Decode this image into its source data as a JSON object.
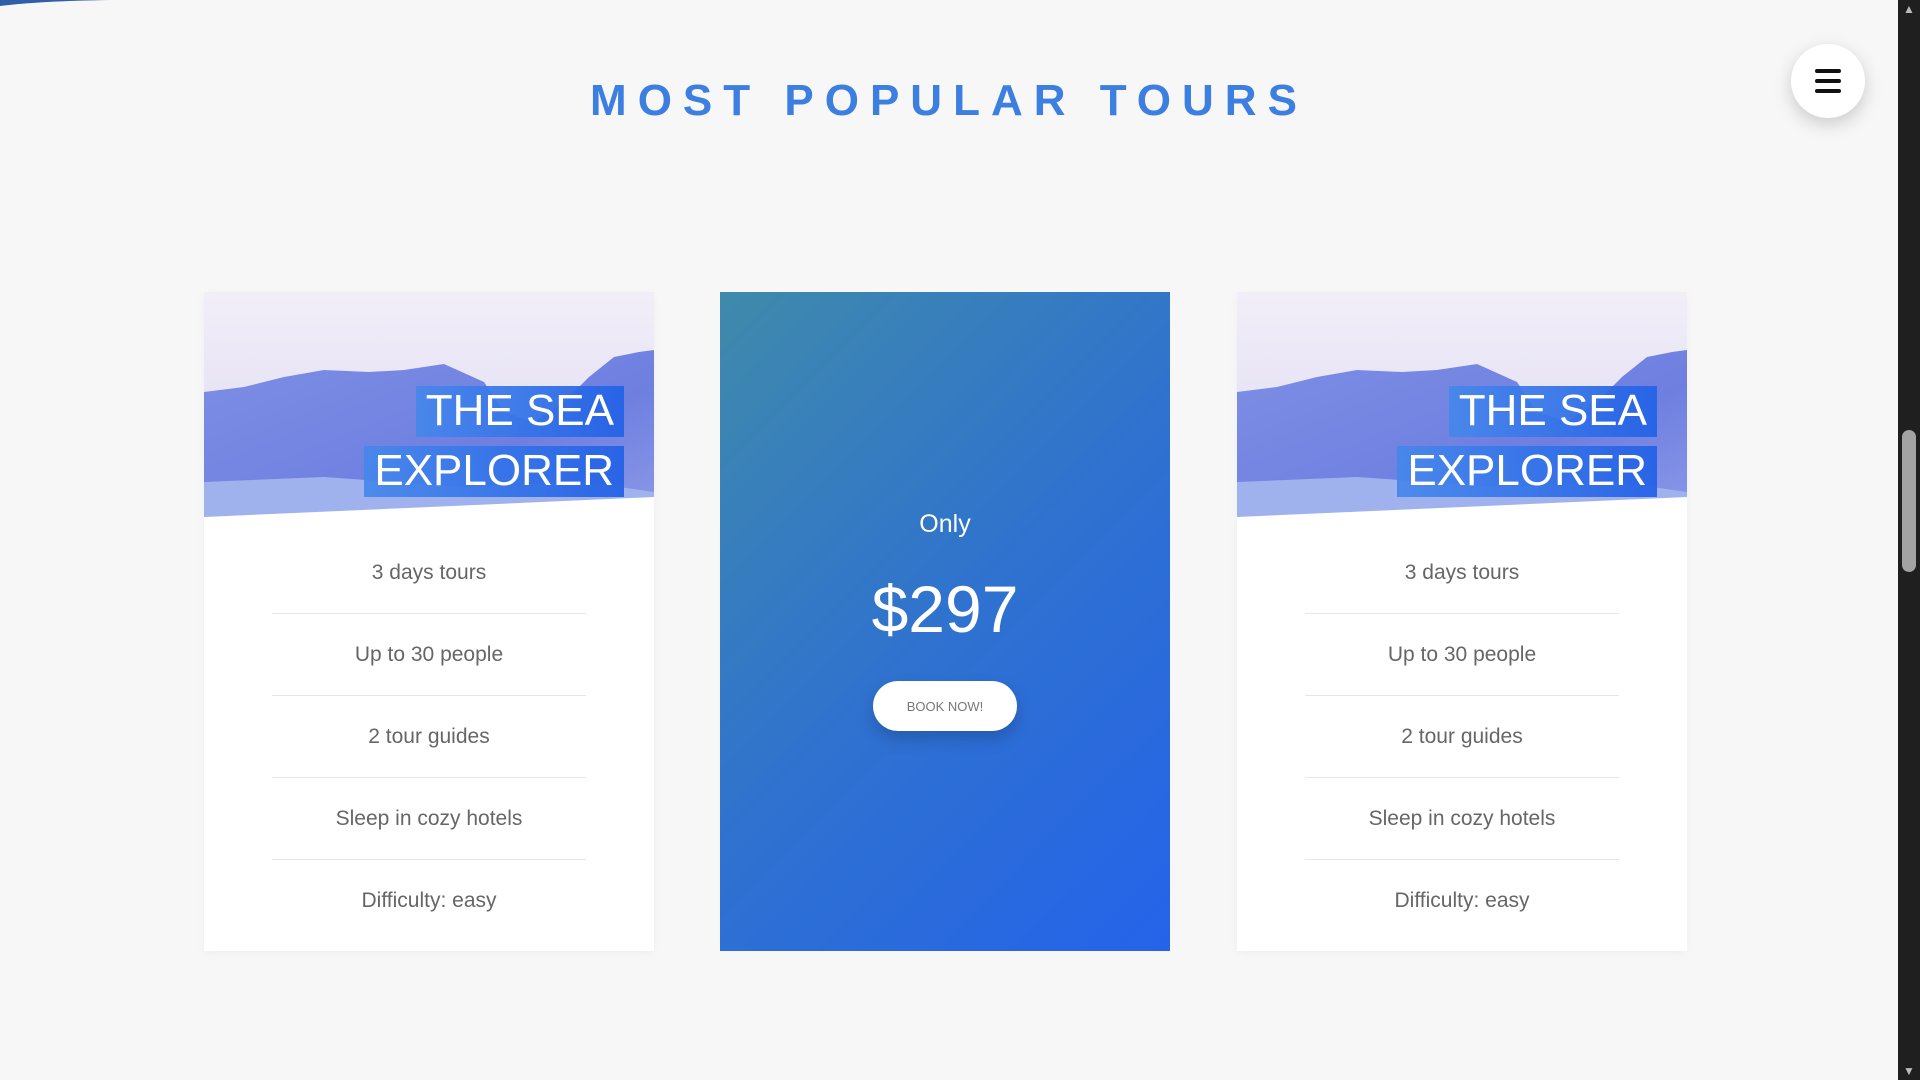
{
  "section": {
    "title": "MOST POPULAR TOURS"
  },
  "menu": {
    "icon": "hamburger-menu-icon"
  },
  "tours": [
    {
      "heading_line_1": "THE SEA",
      "heading_line_2": "EXPLORER",
      "details": [
        "3 days tours",
        "Up to 30 people",
        "2 tour guides",
        "Sleep in cozy hotels",
        "Difficulty: easy"
      ]
    },
    {
      "heading_line_1": "THE SEA",
      "heading_line_2": "EXPLORER",
      "details": [
        "3 days tours",
        "Up to 30 people",
        "2 tour guides",
        "Sleep in cozy hotels",
        "Difficulty: easy"
      ]
    }
  ],
  "pricing": {
    "only_label": "Only",
    "price": "$297",
    "book_label": "BOOK NOW!"
  },
  "colors": {
    "accent": "#3d7fe0",
    "gradient_start": "#3f8aab",
    "gradient_end": "#2563ea",
    "background": "#f7f7f7"
  }
}
